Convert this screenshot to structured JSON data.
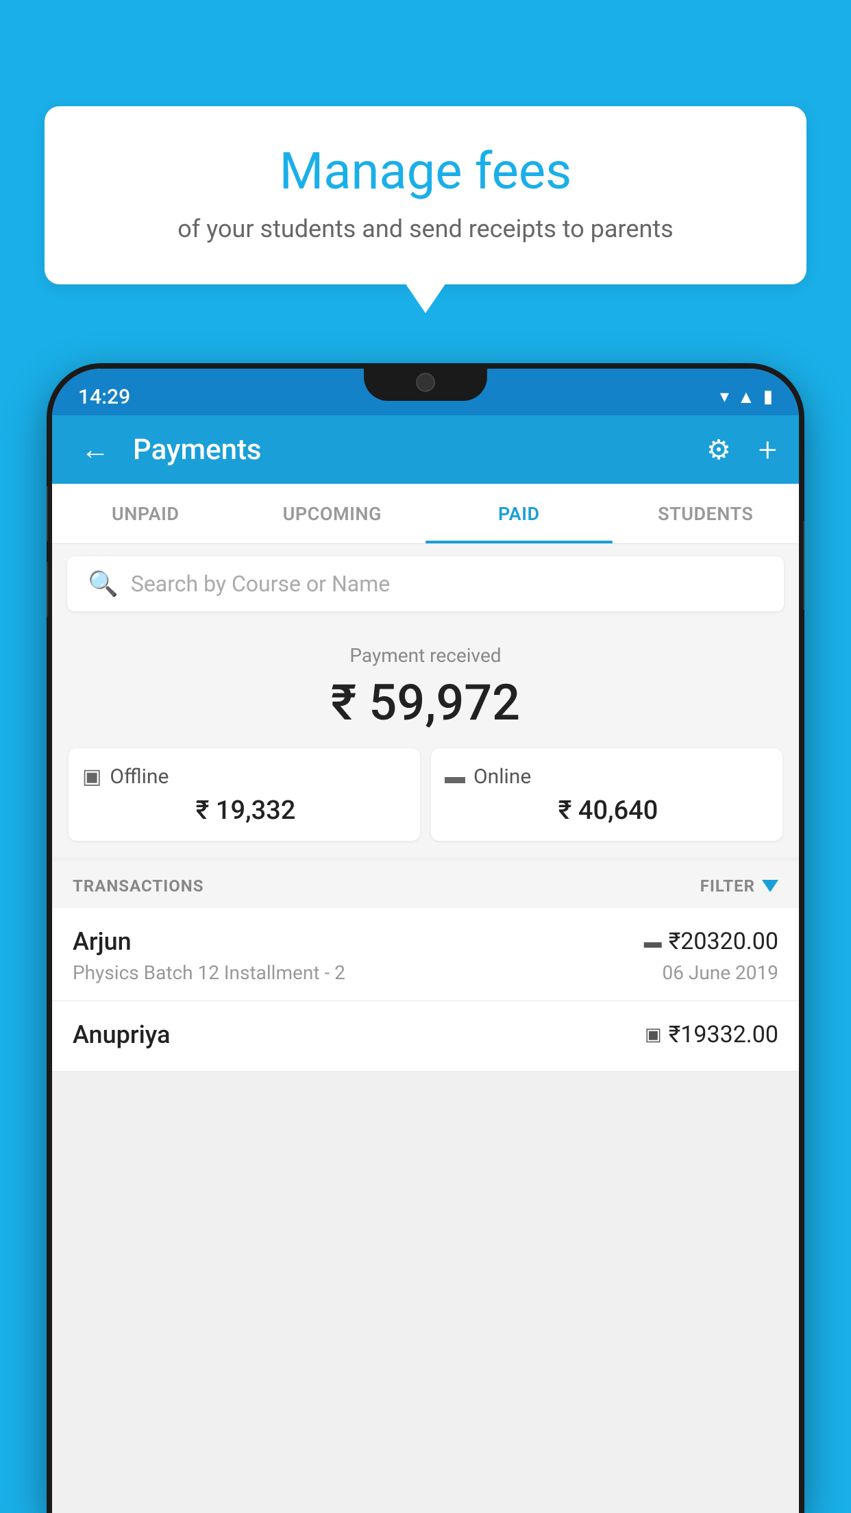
{
  "page": {
    "background_color": "#1AAFE8"
  },
  "bubble": {
    "title": "Manage fees",
    "subtitle": "of your students and send receipts to parents"
  },
  "status_bar": {
    "time": "14:29",
    "icons": [
      "wifi",
      "signal",
      "battery"
    ]
  },
  "header": {
    "title": "Payments",
    "back_label": "←",
    "gear_label": "⚙",
    "plus_label": "+"
  },
  "tabs": [
    {
      "label": "UNPAID",
      "active": false
    },
    {
      "label": "UPCOMING",
      "active": false
    },
    {
      "label": "PAID",
      "active": true
    },
    {
      "label": "STUDENTS",
      "active": false
    }
  ],
  "search": {
    "placeholder": "Search by Course or Name"
  },
  "payment": {
    "received_label": "Payment received",
    "amount": "₹ 59,972",
    "offline_label": "Offline",
    "offline_amount": "₹ 19,332",
    "online_label": "Online",
    "online_amount": "₹ 40,640"
  },
  "transactions": {
    "header_label": "TRANSACTIONS",
    "filter_label": "FILTER",
    "rows": [
      {
        "name": "Arjun",
        "description": "Physics Batch 12 Installment - 2",
        "amount": "₹20320.00",
        "date": "06 June 2019",
        "payment_type": "online"
      },
      {
        "name": "Anupriya",
        "description": "",
        "amount": "₹19332.00",
        "date": "",
        "payment_type": "offline"
      }
    ]
  }
}
